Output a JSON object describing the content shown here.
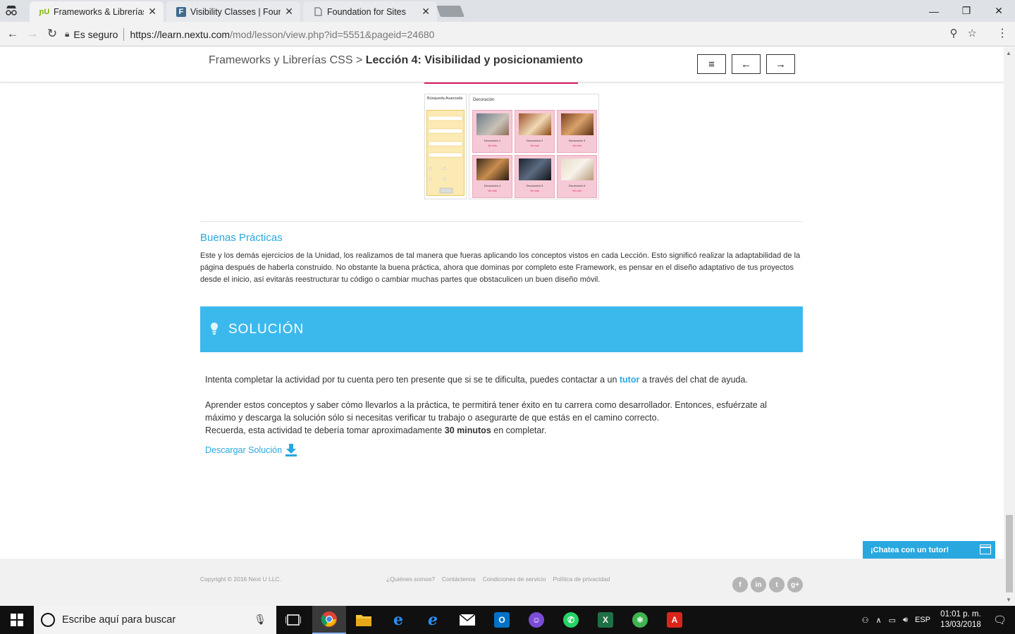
{
  "browser": {
    "tabs": [
      {
        "title": "Frameworks & Librerías C",
        "favicon": "nu",
        "active": true
      },
      {
        "title": "Visibility Classes | Found",
        "favicon": "F",
        "active": false
      },
      {
        "title": "Foundation for Sites",
        "favicon": "page",
        "active": false
      }
    ],
    "secure_label": "Es seguro",
    "url_host": "https://learn.nextu.com",
    "url_path": "/mod/lesson/view.php?id=5551&pageid=24680"
  },
  "lesson": {
    "breadcrumb_course": "Frameworks y Librerías CSS",
    "breadcrumb_sep": ">",
    "breadcrumb_current": "Lección 4: Visibilidad y posicionamiento",
    "menu_icon": "≡",
    "prev_icon": "←",
    "next_icon": "→"
  },
  "mock": {
    "sidebar_title": "Búsqueda Avanzada",
    "main_title": "Decoración",
    "cells": [
      {
        "caption": "Decoración 1",
        "link": "Ver más"
      },
      {
        "caption": "Decoración 2",
        "link": "Ver más"
      },
      {
        "caption": "Decoración 3",
        "link": "Ver más"
      },
      {
        "caption": "Decoración 4",
        "link": "Ver más"
      },
      {
        "caption": "Decoración 5",
        "link": "Ver más"
      },
      {
        "caption": "Decoración 6",
        "link": "Ver más"
      }
    ]
  },
  "content": {
    "bp_title": "Buenas Prácticas",
    "bp_text": "Este y los demás ejercicios de la Unidad, los realizamos de tal manera que fueras aplicando los conceptos vistos en cada Lección. Esto significó realizar la adaptabilidad de la página después de haberla construido. No obstante la buena práctica, ahora que dominas por completo este Framework, es pensar en el diseño adaptativo de tus proyectos desde el inicio, así evitarás reestructurar tu código o cambiar muchas partes que obstaculicen un buen diseño móvil.",
    "solution_title": "SOLUCIÓN",
    "p1_before": "Intenta completar la actividad por tu cuenta pero ten presente que si se te dificulta, puedes contactar a un ",
    "p1_link": "tutor",
    "p1_after": " a través del chat de ayuda.",
    "p2": "Aprender estos conceptos y saber cómo llevarlos a la práctica, te permitirá tener éxito en tu carrera como desarrollador. Entonces, esfuérzate al máximo y descarga la solución sólo si necesitas verificar tu trabajo o asegurarte de que estás en el camino correcto.",
    "p3_before": "Recuerda, esta actividad te debería tomar aproximadamente ",
    "p3_bold": "30 minutos",
    "p3_after": " en completar.",
    "download": "Descargar Solución"
  },
  "footer": {
    "copyright": "Copyright © 2016 Next U LLC.",
    "links": [
      "¿Quiénes somos?",
      "Contáctenos",
      "Condiciones de servicio",
      "Política de privacidad"
    ],
    "social": [
      "f",
      "in",
      "t",
      "g+"
    ],
    "chat": "¡Chatea con un tutor!"
  },
  "taskbar": {
    "search_placeholder": "Escribe aquí para buscar",
    "lang": "ESP",
    "time": "01:01 p. m.",
    "date": "13/03/2018"
  },
  "colors": {
    "accent": "#3cb9ec",
    "link": "#29a8e0",
    "brand_pink": "#e51f6a"
  }
}
